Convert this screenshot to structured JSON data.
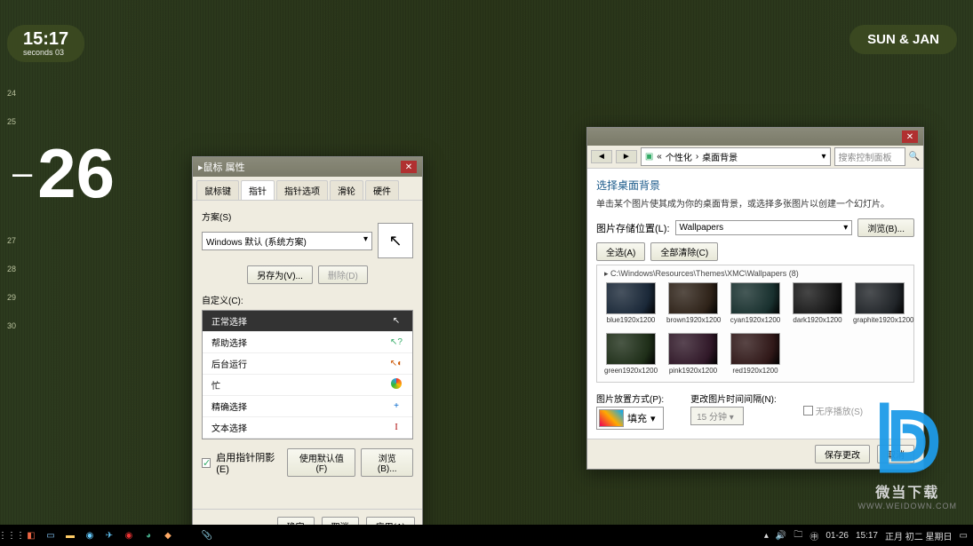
{
  "clock": {
    "time": "15:17",
    "seconds": "seconds 03"
  },
  "date_badge": "SUN & JAN",
  "big_number": {
    "dash": "–",
    "value": "26"
  },
  "ticks": [
    "24",
    "25",
    "",
    "27",
    "28",
    "29",
    "30"
  ],
  "mouse_window": {
    "title": "鼠标 属性",
    "tabs": [
      "鼠标键",
      "指针",
      "指针选项",
      "滑轮",
      "硬件"
    ],
    "active_tab_index": 1,
    "scheme_label": "方案(S)",
    "scheme_value": "Windows 默认 (系统方案)",
    "save_as": "另存为(V)...",
    "delete": "删除(D)",
    "customize_label": "自定义(C):",
    "cursors": [
      {
        "name": "正常选择",
        "icon": "↖",
        "selected": true
      },
      {
        "name": "帮助选择",
        "icon": "↖?",
        "selected": false
      },
      {
        "name": "后台运行",
        "icon": "↖◐",
        "selected": false
      },
      {
        "name": "忙",
        "icon": "○",
        "selected": false
      },
      {
        "name": "精确选择",
        "icon": "+",
        "selected": false
      },
      {
        "name": "文本选择",
        "icon": "I",
        "selected": false
      }
    ],
    "enable_shadow": "启用指针阴影(E)",
    "use_default": "使用默认值(F)",
    "browse": "浏览(B)...",
    "ok": "确定",
    "cancel": "取消",
    "apply": "应用(A)"
  },
  "wall_window": {
    "breadcrumb_parent": "个性化",
    "breadcrumb_current": "桌面背景",
    "search_placeholder": "搜索控制面板",
    "heading": "选择桌面背景",
    "description": "单击某个图片使其成为你的桌面背景，或选择多张图片以创建一个幻灯片。",
    "location_label": "图片存储位置(L):",
    "location_value": "Wallpapers",
    "browse": "浏览(B)...",
    "select_all": "全选(A)",
    "clear_all": "全部清除(C)",
    "path": "C:\\Windows\\Resources\\Themes\\XMC\\Wallpapers (8)",
    "thumbs": [
      {
        "label": "blue1920x1200",
        "color": "#1a2838"
      },
      {
        "label": "brown1920x1200",
        "color": "#2e2218"
      },
      {
        "label": "cyan1920x1200",
        "color": "#18302e"
      },
      {
        "label": "dark1920x1200",
        "color": "#181818"
      },
      {
        "label": "graphite1920x1200",
        "color": "#202428"
      },
      {
        "label": "green1920x1200",
        "color": "#1e2e18"
      },
      {
        "label": "pink1920x1200",
        "color": "#301828"
      },
      {
        "label": "red1920x1200",
        "color": "#301818"
      }
    ],
    "fit_label": "图片放置方式(P):",
    "fit_value": "填充",
    "timing_label": "更改图片时间间隔(N):",
    "timing_value": "15 分钟",
    "shuffle": "无序播放(S)",
    "save": "保存更改",
    "cancel": "取消"
  },
  "taskbar_tray": {
    "date": "01-26",
    "time": "15:17",
    "lunar": "正月 初二 星期日"
  },
  "watermark": {
    "text": "微当下载",
    "url": "WWW.WEIDOWN.COM"
  }
}
